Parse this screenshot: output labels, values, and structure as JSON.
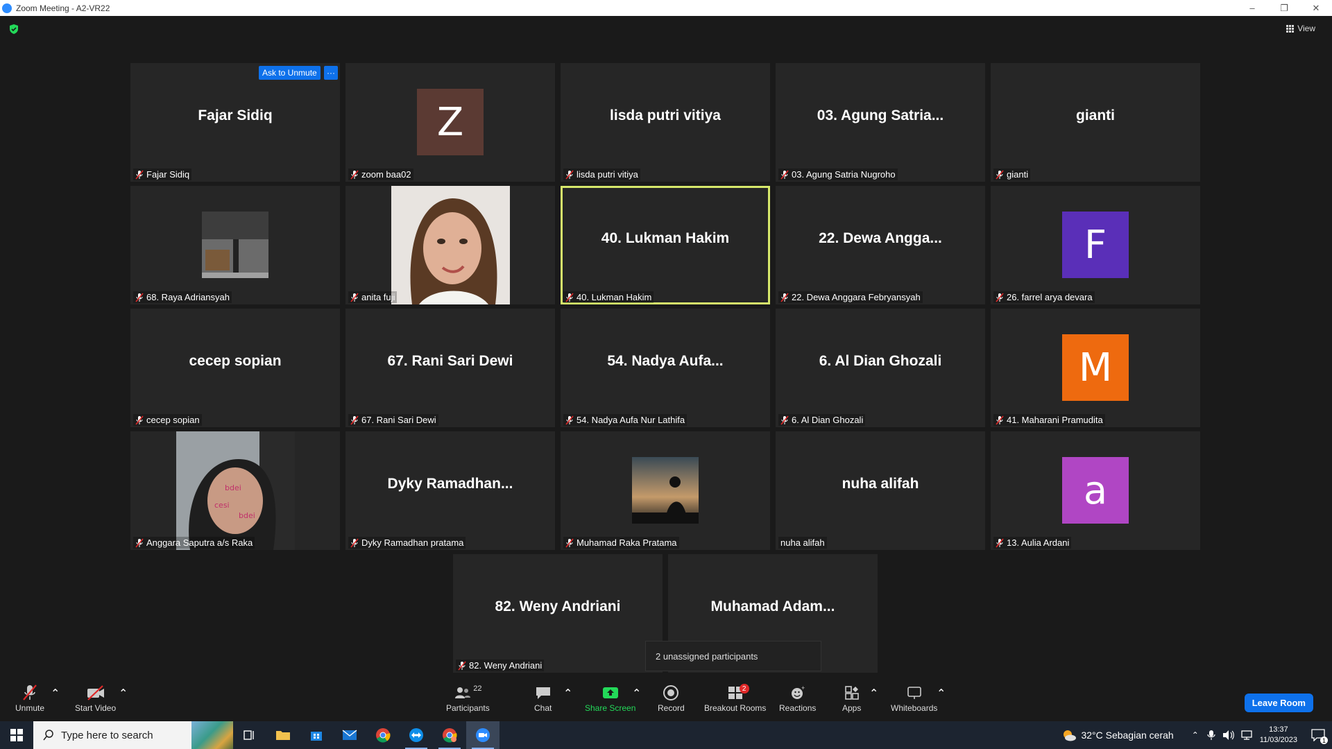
{
  "window": {
    "title": "Zoom Meeting - A2-VR22"
  },
  "top": {
    "view_label": "View"
  },
  "tiles": [
    {
      "name": "Fajar Sidiq",
      "label": "Fajar Sidiq",
      "muted": true,
      "kind": "text"
    },
    {
      "name": "Z",
      "label": "zoom baa02",
      "muted": true,
      "kind": "avatar",
      "color": "#5b3a33"
    },
    {
      "name": "lisda putri vitiya",
      "label": "lisda putri vitiya",
      "muted": true,
      "kind": "text"
    },
    {
      "name": "03. Agung Satria...",
      "label": "03. Agung Satria Nugroho",
      "muted": true,
      "kind": "text"
    },
    {
      "name": "gianti",
      "label": "gianti",
      "muted": true,
      "kind": "text"
    },
    {
      "name": "",
      "label": "68. Raya Adriansyah",
      "muted": true,
      "kind": "picture"
    },
    {
      "name": "",
      "label": "anita fuji",
      "muted": true,
      "kind": "photo"
    },
    {
      "name": "40. Lukman Hakim",
      "label": "40. Lukman Hakim",
      "muted": true,
      "kind": "text",
      "active": true
    },
    {
      "name": "22. Dewa Angga...",
      "label": "22. Dewa Anggara Febryansyah",
      "muted": true,
      "kind": "text"
    },
    {
      "name": "F",
      "label": "26. farrel arya devara",
      "muted": true,
      "kind": "avatar",
      "color": "#5a2fb8"
    },
    {
      "name": "cecep sopian",
      "label": "cecep sopian",
      "muted": true,
      "kind": "text"
    },
    {
      "name": "67. Rani Sari Dewi",
      "label": "67. Rani Sari Dewi",
      "muted": true,
      "kind": "text"
    },
    {
      "name": "54. Nadya Aufa...",
      "label": "54. Nadya Aufa Nur Lathifa",
      "muted": true,
      "kind": "text"
    },
    {
      "name": "6. Al Dian Ghozali",
      "label": "6. Al Dian Ghozali",
      "muted": true,
      "kind": "text"
    },
    {
      "name": "M",
      "label": "41. Maharani Pramudita",
      "muted": true,
      "kind": "avatar",
      "color": "#ee6a0f"
    },
    {
      "name": "",
      "label": "Anggara Saputra a/s Raka",
      "muted": true,
      "kind": "photo2"
    },
    {
      "name": "Dyky  Ramadhan...",
      "label": "Dyky Ramadhan pratama",
      "muted": true,
      "kind": "text"
    },
    {
      "name": "",
      "label": "Muhamad Raka Pratama",
      "muted": true,
      "kind": "picture2"
    },
    {
      "name": "nuha alifah",
      "label": "nuha alifah",
      "muted": false,
      "kind": "text"
    },
    {
      "name": "a",
      "label": "13. Aulia Ardani",
      "muted": true,
      "kind": "avatar",
      "color": "#b046c4"
    },
    {
      "name": "82. Weny Andriani",
      "label": "82. Weny Andriani",
      "muted": true,
      "kind": "text"
    },
    {
      "name": "Muhamad  Adam...",
      "label": "",
      "muted": false,
      "kind": "text"
    }
  ],
  "hover": {
    "ask_unmute": "Ask to Unmute",
    "more": "···"
  },
  "tooltip": "2 unassigned participants",
  "toolbar": {
    "unmute": "Unmute",
    "start_video": "Start Video",
    "participants": "Participants",
    "participants_count": "22",
    "chat": "Chat",
    "share_screen": "Share Screen",
    "record": "Record",
    "breakout_rooms": "Breakout Rooms",
    "breakout_badge": "2",
    "reactions": "Reactions",
    "apps": "Apps",
    "whiteboards": "Whiteboards",
    "leave": "Leave Room"
  },
  "taskbar": {
    "search_placeholder": "Type here to search",
    "weather": "32°C  Sebagian cerah",
    "time": "13:37",
    "date": "11/03/2023",
    "notif_count": "1"
  }
}
